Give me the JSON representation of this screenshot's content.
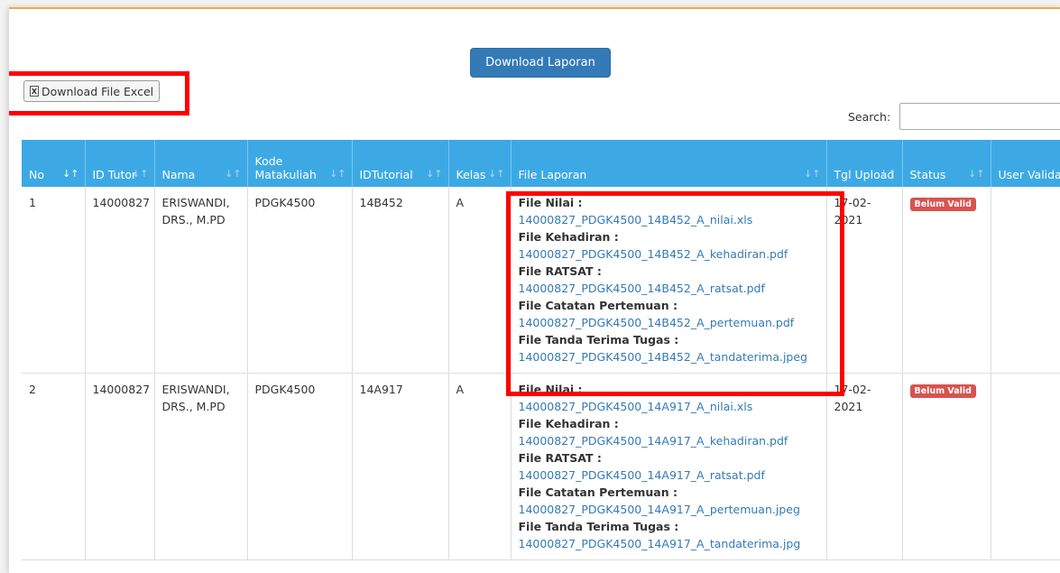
{
  "buttons": {
    "download_laporan": "Download Laporan",
    "download_excel": "Download File Excel"
  },
  "search": {
    "label": "Search:",
    "placeholder": ""
  },
  "table": {
    "headers": [
      {
        "label": "No",
        "sort": "↓↑"
      },
      {
        "label": "ID Tutor",
        "sort": "↓↑"
      },
      {
        "label": "Nama",
        "sort": "↓↑"
      },
      {
        "label": "Kode Matakuliah",
        "sort": "↓↑"
      },
      {
        "label": "IDTutorial",
        "sort": "↓↑"
      },
      {
        "label": "Kelas",
        "sort": "↓↑"
      },
      {
        "label": "File Laporan",
        "sort": "↓↑"
      },
      {
        "label": "Tgl Upload",
        "sort": "↓↑"
      },
      {
        "label": "Status",
        "sort": "↓↑"
      },
      {
        "label": "User Validasi",
        "sort": ""
      }
    ],
    "rows": [
      {
        "no": "1",
        "id_tutor": "14000827",
        "nama": "ERISWANDI, DRS., M.PD",
        "kode": "PDGK4500",
        "idtutorial": "14B452",
        "kelas": "A",
        "files": [
          {
            "label": "File Nilai :",
            "link": "14000827_PDGK4500_14B452_A_nilai.xls"
          },
          {
            "label": "File Kehadiran :",
            "link": "14000827_PDGK4500_14B452_A_kehadiran.pdf"
          },
          {
            "label": "File RATSAT :",
            "link": "14000827_PDGK4500_14B452_A_ratsat.pdf"
          },
          {
            "label": "File Catatan Pertemuan :",
            "link": "14000827_PDGK4500_14B452_A_pertemuan.pdf"
          },
          {
            "label": "File Tanda Terima Tugas :",
            "link": "14000827_PDGK4500_14B452_A_tandaterima.jpeg"
          }
        ],
        "tgl": "17-02-2021",
        "status": "Belum Valid",
        "user": ""
      },
      {
        "no": "2",
        "id_tutor": "14000827",
        "nama": "ERISWANDI, DRS., M.PD",
        "kode": "PDGK4500",
        "idtutorial": "14A917",
        "kelas": "A",
        "files": [
          {
            "label": "File Nilai :",
            "link": "14000827_PDGK4500_14A917_A_nilai.xls"
          },
          {
            "label": "File Kehadiran :",
            "link": "14000827_PDGK4500_14A917_A_kehadiran.pdf"
          },
          {
            "label": "File RATSAT :",
            "link": "14000827_PDGK4500_14A917_A_ratsat.pdf"
          },
          {
            "label": "File Catatan Pertemuan :",
            "link": "14000827_PDGK4500_14A917_A_pertemuan.jpeg"
          },
          {
            "label": "File Tanda Terima Tugas :",
            "link": "14000827_PDGK4500_14A917_A_tandaterima.jpg"
          }
        ],
        "tgl": "17-02-2021",
        "status": "Belum Valid",
        "user": ""
      }
    ]
  },
  "colors": {
    "header_bg": "#3ca9e5",
    "primary_button": "#337ab7",
    "badge_danger": "#d9534f",
    "highlight_box": "#ff0000",
    "top_border": "#f0a94a"
  }
}
